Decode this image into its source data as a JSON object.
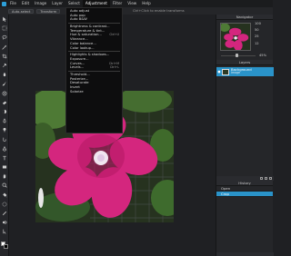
{
  "menubar": {
    "items": [
      "File",
      "Edit",
      "Image",
      "Layer",
      "Select",
      "Adjustment",
      "Filter",
      "View",
      "Help"
    ],
    "active_item": "Adjustment"
  },
  "options": {
    "buttons": [
      "Auto-select",
      "Transform"
    ],
    "hint": "Ctrl+Click to enable transforms"
  },
  "adjustment_menu": {
    "groups": [
      [
        {
          "label": "Auto adjust",
          "shortcut": ""
        },
        {
          "label": "Auto pop",
          "shortcut": ""
        },
        {
          "label": "Auto B&W",
          "shortcut": ""
        }
      ],
      [
        {
          "label": "Brightness & contrast...",
          "shortcut": ""
        },
        {
          "label": "Temperature & tint...",
          "shortcut": ""
        },
        {
          "label": "Hue & saturation...",
          "shortcut": "Ctrl+U"
        },
        {
          "label": "Vibrance...",
          "shortcut": ""
        },
        {
          "label": "Color balance...",
          "shortcut": ""
        },
        {
          "label": "Color lookup...",
          "shortcut": ""
        }
      ],
      [
        {
          "label": "Highlights & shadows...",
          "shortcut": ""
        },
        {
          "label": "Exposure...",
          "shortcut": ""
        },
        {
          "label": "Curves...",
          "shortcut": "Ctrl+M"
        },
        {
          "label": "Levels...",
          "shortcut": "Ctrl+L"
        }
      ],
      [
        {
          "label": "Threshold...",
          "shortcut": ""
        },
        {
          "label": "Posterize...",
          "shortcut": ""
        },
        {
          "label": "Desaturate",
          "shortcut": ""
        },
        {
          "label": "Invert",
          "shortcut": ""
        },
        {
          "label": "Solarize",
          "shortcut": ""
        }
      ]
    ]
  },
  "navigator": {
    "title": "Navigator",
    "zoom_levels": [
      "100",
      "50",
      "25",
      "12"
    ],
    "zoom_pct": "45%",
    "zoom_fraction": 0.45
  },
  "layers": {
    "title": "Layers",
    "items": [
      {
        "name": "Background",
        "sub": "Image",
        "selected": true
      }
    ]
  },
  "history": {
    "title": "History",
    "items": [
      {
        "label": "Open",
        "active": false
      },
      {
        "label": "Crop",
        "active": true
      }
    ]
  },
  "tools": [
    "move-tool",
    "marquee-tool",
    "lasso-tool",
    "magic-wand-tool",
    "crop-tool",
    "eyedropper-tool",
    "healing-tool",
    "brush-tool",
    "clone-tool",
    "eraser-tool",
    "gradient-tool",
    "blur-tool",
    "dodge-tool",
    "smudge-tool",
    "pen-tool",
    "type-tool",
    "shape-tool",
    "hand-tool",
    "zoom-tool",
    "fill-tool",
    "sponge-tool",
    "pencil-tool",
    "color-replace-tool",
    "path-select-tool"
  ],
  "colors": {
    "accent": "#2a93c9",
    "foreground": "#ffffff",
    "background": "#000000",
    "flower": "#d4267e"
  }
}
